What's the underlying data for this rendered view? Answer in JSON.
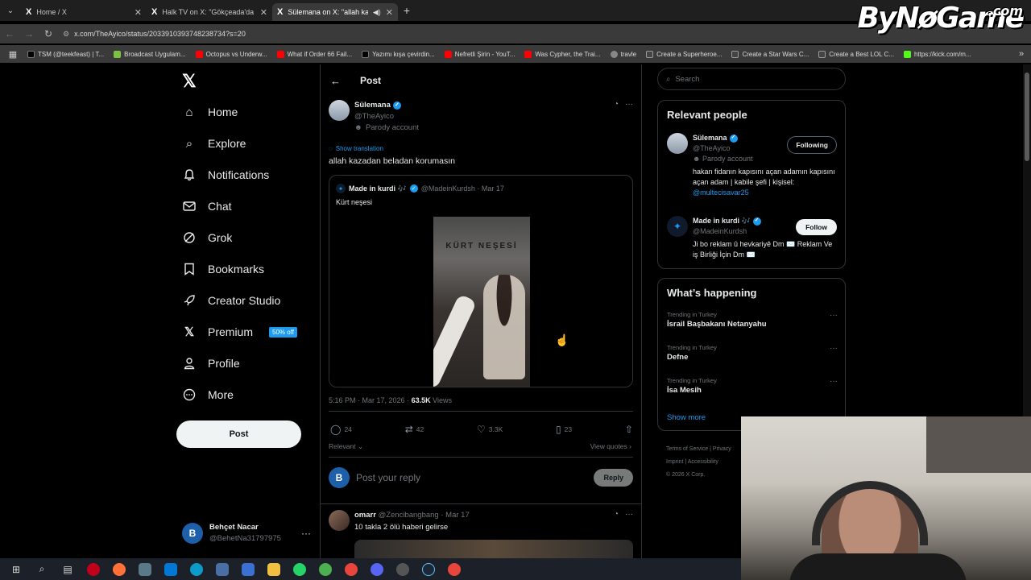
{
  "browser": {
    "tabs": [
      {
        "title": "Home / X",
        "active": false
      },
      {
        "title": "Halk TV on X: \"Gökçeada'da iki",
        "active": false
      },
      {
        "title": "Sülemana on X: \"allah kaza",
        "active": true
      }
    ],
    "url": "x.com/TheAyico/status/2033910393748238734?s=20",
    "bookmarks": [
      {
        "label": "TSM (@teekfeast) | T...",
        "color": "#000000"
      },
      {
        "label": "Broadcast Uygulam...",
        "color": "#7cc242"
      },
      {
        "label": "Octopus vs Underw...",
        "color": "#ff0000"
      },
      {
        "label": "What if Order 66 Fail...",
        "color": "#ff0000"
      },
      {
        "label": "Yazımı kışa çevirdin...",
        "color": "#000000"
      },
      {
        "label": "Nefretli Şirin - YouT...",
        "color": "#ff0000"
      },
      {
        "label": "Was Cypher, the Trai...",
        "color": "#ff0000"
      },
      {
        "label": "travle",
        "color": "#888888"
      },
      {
        "label": "Create a Superheroe...",
        "color": "#444444"
      },
      {
        "label": "Create a Star Wars C...",
        "color": "#444444"
      },
      {
        "label": "Create a Best LOL C...",
        "color": "#444444"
      },
      {
        "label": "https://kick.com/m...",
        "color": "#53fc18"
      }
    ]
  },
  "watermark": {
    "main": "ByNøGame",
    "suffix": ".com"
  },
  "nav": {
    "items": [
      {
        "label": "Home",
        "icon": "home-icon",
        "glyph": "⌂"
      },
      {
        "label": "Explore",
        "icon": "search-icon",
        "glyph": "⌕"
      },
      {
        "label": "Notifications",
        "icon": "bell-icon",
        "glyph": "🔔"
      },
      {
        "label": "Chat",
        "icon": "mail-icon",
        "glyph": "✉"
      },
      {
        "label": "Grok",
        "icon": "grok-icon",
        "glyph": "◔"
      },
      {
        "label": "Bookmarks",
        "icon": "bookmark-icon",
        "glyph": "▯"
      },
      {
        "label": "Creator Studio",
        "icon": "rocket-icon",
        "glyph": "➚"
      },
      {
        "label": "Premium",
        "icon": "x-icon",
        "glyph": "𝕏"
      },
      {
        "label": "Profile",
        "icon": "person-icon",
        "glyph": "☺"
      },
      {
        "label": "More",
        "icon": "more-circle-icon",
        "glyph": "⊙"
      }
    ],
    "premium_badge": "50% off",
    "post_label": "Post",
    "account_name": "Behçet Nacar",
    "account_handle": "@BehetNa31797975",
    "account_initial": "B"
  },
  "post": {
    "header_title": "Post",
    "author_name": "Sülemana",
    "author_handle": "@TheAyico",
    "author_label": "Parody account",
    "show_translation": "Show translation",
    "text": "allah kazadan beladan korumasın",
    "quote": {
      "name": "Made in kurdi 🎶",
      "meta": "@MadeinKurdsh · Mar 17",
      "text": "Kürt neşesi",
      "video_title": "KÜRT NEŞESİ"
    },
    "time": "5:16 PM · Mar 17, 2026 ·",
    "views_count": "63.5K",
    "views_label": "Views",
    "stats": {
      "replies": "24",
      "reposts": "42",
      "likes": "3.3K",
      "bookmarks": "23"
    },
    "relevant_label": "Relevant",
    "view_quotes_label": "View quotes",
    "reply_placeholder": "Post your reply",
    "reply_button": "Reply",
    "reply_avatar_initial": "B"
  },
  "reply": {
    "name": "omarr",
    "meta": "@Zencibangbang · Mar 17",
    "text": "10 takla 2 ölü haberi gelirse"
  },
  "sidebar": {
    "search_placeholder": "Search",
    "relevant_title": "Relevant people",
    "people": [
      {
        "name": "Sülemana",
        "handle": "@TheAyico",
        "label": "Parody account",
        "bio": "hakan fidanın kapısını açan adamın kapısını açan adam | kabile şefi | kişisel:",
        "link": "@multecisavar25",
        "button": "Following"
      },
      {
        "name": "Made in kurdi 🎶",
        "handle": "@MadeinKurdsh",
        "bio": "Ji bo reklam û hevkariyê Dm ✉️ Reklam Ve iş Birliği İçin Dm ✉️",
        "button": "Follow"
      }
    ],
    "happening_title": "What’s happening",
    "trends": [
      {
        "category": "Trending in Turkey",
        "name": "İsrail Başbakanı Netanyahu"
      },
      {
        "category": "Trending in Turkey",
        "name": "Defne"
      },
      {
        "category": "Trending in Turkey",
        "name": "İsa Mesih"
      }
    ],
    "show_more": "Show more",
    "footer": [
      "Terms of Service",
      "Privacy",
      "Imprint",
      "Accessibility",
      "© 2026 X Corp."
    ]
  }
}
